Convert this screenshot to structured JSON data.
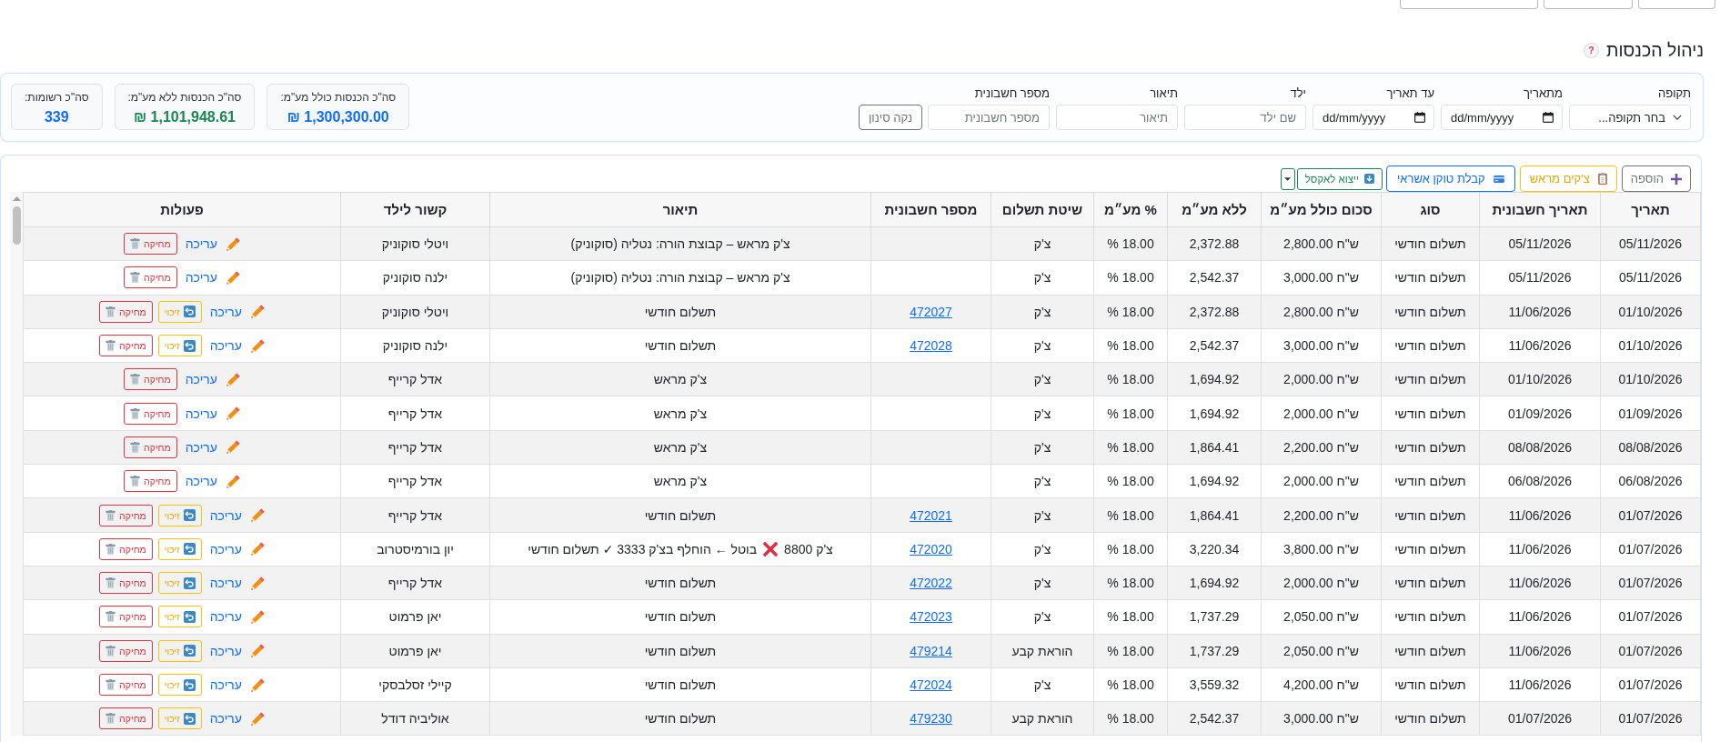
{
  "top_buttons": [
    {
      "kind": "cut-off"
    },
    {
      "kind": "cut-off"
    },
    {
      "kind": "cut-off"
    }
  ],
  "header": {
    "title": "ניהול הכנסות",
    "help": "?"
  },
  "filters": {
    "fields": [
      {
        "kind": "select",
        "label": "תקופה",
        "value": "בחר תקופה..."
      },
      {
        "kind": "date",
        "label": "מתאריך",
        "placeholder": "dd/mm/yyyy"
      },
      {
        "kind": "date",
        "label": "עד תאריך",
        "placeholder": "dd/mm/yyyy"
      },
      {
        "kind": "text",
        "label": "ילד",
        "placeholder": "שם ילד"
      },
      {
        "kind": "text",
        "label": "תיאור",
        "placeholder": "תיאור"
      },
      {
        "kind": "text",
        "label": "מספר חשבונית",
        "placeholder": "מספר חשבונית"
      }
    ],
    "clear_button": "נקה סינון"
  },
  "stats": [
    {
      "label": "סה\"כ הכנסות כולל מע\"מ:",
      "value": "1,300,300.00 ₪",
      "color": "#0d6efd"
    },
    {
      "label": "סה\"כ הכנסות ללא מע\"מ:",
      "value": "1,101,948.61 ₪",
      "color": "#198754"
    },
    {
      "label": "סה\"כ רשומות:",
      "value": "339",
      "color": "#0d6efd"
    }
  ],
  "toolbar": [
    {
      "kind": "add",
      "label": "הוספה"
    },
    {
      "kind": "checks",
      "label": "צ'קים מראש"
    },
    {
      "kind": "token",
      "label": "קבלת טוקן אשראי"
    },
    {
      "kind": "export",
      "label": "ייצוא לאקסל"
    },
    {
      "kind": "dropdown"
    }
  ],
  "table": {
    "scrollable": true,
    "columns": [
      "תאריך",
      "תאריך חשבונית",
      "סוג",
      "סכום כולל מע״מ",
      "ללא מע״מ",
      "% מע״מ",
      "שיטת תשלום",
      "מספר חשבונית",
      "תיאור",
      "קשור לילד",
      "פעולות"
    ],
    "rows": [
      {
        "date": "05/11/2026",
        "invoice_date": "05/11/2026",
        "type": "תשלום חודשי",
        "total": "2,800.00 ש\"ח",
        "net": "2,372.88",
        "vat": "18.00 %",
        "payment_method": "צ'ק",
        "description": "צ'ק מראש – קבוצת הורה: נטליה (סוקוניק)",
        "child": "ויטלי סוקוניק",
        "actions": [
          {
            "kind": "edit",
            "label": "עריכה"
          },
          {
            "kind": "delete",
            "label": "מחיקה"
          }
        ]
      },
      {
        "date": "05/11/2026",
        "invoice_date": "05/11/2026",
        "type": "תשלום חודשי",
        "total": "3,000.00 ש\"ח",
        "net": "2,542.37",
        "vat": "18.00 %",
        "payment_method": "צ'ק",
        "description": "צ'ק מראש – קבוצת הורה: נטליה (סוקוניק)",
        "child": "ילנה סוקוניק",
        "actions": [
          {
            "kind": "edit",
            "label": "עריכה"
          },
          {
            "kind": "delete",
            "label": "מחיקה"
          }
        ]
      },
      {
        "date": "01/10/2026",
        "invoice_date": "11/06/2026",
        "type": "תשלום חודשי",
        "total": "2,800.00 ש\"ח",
        "net": "2,372.88",
        "vat": "18.00 %",
        "payment_method": "צ'ק",
        "invoice_number": "472027",
        "description": "תשלום חודשי",
        "child": "ויטלי סוקוניק",
        "actions": [
          {
            "kind": "edit",
            "label": "עריכה"
          },
          {
            "kind": "credit",
            "label": "זיכוי"
          },
          {
            "kind": "delete",
            "label": "מחיקה"
          }
        ]
      },
      {
        "date": "01/10/2026",
        "invoice_date": "11/06/2026",
        "type": "תשלום חודשי",
        "total": "3,000.00 ש\"ח",
        "net": "2,542.37",
        "vat": "18.00 %",
        "payment_method": "צ'ק",
        "invoice_number": "472028",
        "description": "תשלום חודשי",
        "child": "ילנה סוקוניק",
        "actions": [
          {
            "kind": "edit",
            "label": "עריכה"
          },
          {
            "kind": "credit",
            "label": "זיכוי"
          },
          {
            "kind": "delete",
            "label": "מחיקה"
          }
        ]
      },
      {
        "date": "01/10/2026",
        "invoice_date": "01/10/2026",
        "type": "תשלום חודשי",
        "total": "2,000.00 ש\"ח",
        "net": "1,694.92",
        "vat": "18.00 %",
        "payment_method": "צ'ק",
        "description": "צ'ק מראש",
        "child": "אדל קרייף",
        "actions": [
          {
            "kind": "edit",
            "label": "עריכה"
          },
          {
            "kind": "delete",
            "label": "מחיקה"
          }
        ]
      },
      {
        "date": "01/09/2026",
        "invoice_date": "01/09/2026",
        "type": "תשלום חודשי",
        "total": "2,000.00 ש\"ח",
        "net": "1,694.92",
        "vat": "18.00 %",
        "payment_method": "צ'ק",
        "description": "צ'ק מראש",
        "child": "אדל קרייף",
        "actions": [
          {
            "kind": "edit",
            "label": "עריכה"
          },
          {
            "kind": "delete",
            "label": "מחיקה"
          }
        ]
      },
      {
        "date": "08/08/2026",
        "invoice_date": "08/08/2026",
        "type": "תשלום חודשי",
        "total": "2,200.00 ש\"ח",
        "net": "1,864.41",
        "vat": "18.00 %",
        "payment_method": "צ'ק",
        "description": "צ'ק מראש",
        "child": "אדל קרייף",
        "actions": [
          {
            "kind": "edit",
            "label": "עריכה"
          },
          {
            "kind": "delete",
            "label": "מחיקה"
          }
        ]
      },
      {
        "date": "06/08/2026",
        "invoice_date": "06/08/2026",
        "type": "תשלום חודשי",
        "total": "2,000.00 ש\"ח",
        "net": "1,694.92",
        "vat": "18.00 %",
        "payment_method": "צ'ק",
        "description": "צ'ק מראש",
        "child": "אדל קרייף",
        "actions": [
          {
            "kind": "edit",
            "label": "עריכה"
          },
          {
            "kind": "delete",
            "label": "מחיקה"
          }
        ]
      },
      {
        "date": "01/07/2026",
        "invoice_date": "11/06/2026",
        "type": "תשלום חודשי",
        "total": "2,200.00 ש\"ח",
        "net": "1,864.41",
        "vat": "18.00 %",
        "payment_method": "צ'ק",
        "invoice_number": "472021",
        "description": "תשלום חודשי",
        "child": "אדל קרייף",
        "actions": [
          {
            "kind": "edit",
            "label": "עריכה"
          },
          {
            "kind": "credit",
            "label": "זיכוי"
          },
          {
            "kind": "delete",
            "label": "מחיקה"
          }
        ]
      },
      {
        "date": "01/07/2026",
        "invoice_date": "11/06/2026",
        "type": "תשלום חודשי",
        "total": "3,800.00 ש\"ח",
        "net": "3,220.34",
        "vat": "18.00 %",
        "payment_method": "צ'ק",
        "invoice_number": "472020",
        "description": [
          {
            "kind": "text",
            "text": "צ'ק 8800"
          },
          {
            "kind": "icon"
          },
          {
            "kind": "text",
            "text": "בוטל ← הוחלף בצ'ק 3333 ✓ תשלום חודשי"
          }
        ],
        "child": "יון בורמיסטרוב",
        "actions": [
          {
            "kind": "edit",
            "label": "עריכה"
          },
          {
            "kind": "credit",
            "label": "זיכוי"
          },
          {
            "kind": "delete",
            "label": "מחיקה"
          }
        ]
      },
      {
        "date": "01/07/2026",
        "invoice_date": "11/06/2026",
        "type": "תשלום חודשי",
        "total": "2,000.00 ש\"ח",
        "net": "1,694.92",
        "vat": "18.00 %",
        "payment_method": "צ'ק",
        "invoice_number": "472022",
        "description": "תשלום חודשי",
        "child": "אדל קרייף",
        "actions": [
          {
            "kind": "edit",
            "label": "עריכה"
          },
          {
            "kind": "credit",
            "label": "זיכוי"
          },
          {
            "kind": "delete",
            "label": "מחיקה"
          }
        ]
      },
      {
        "date": "01/07/2026",
        "invoice_date": "11/06/2026",
        "type": "תשלום חודשי",
        "total": "2,050.00 ש\"ח",
        "net": "1,737.29",
        "vat": "18.00 %",
        "payment_method": "צ'ק",
        "invoice_number": "472023",
        "description": "תשלום חודשי",
        "child": "יאן פרמוט",
        "actions": [
          {
            "kind": "edit",
            "label": "עריכה"
          },
          {
            "kind": "credit",
            "label": "זיכוי"
          },
          {
            "kind": "delete",
            "label": "מחיקה"
          }
        ]
      },
      {
        "date": "01/07/2026",
        "invoice_date": "11/06/2026",
        "type": "תשלום חודשי",
        "total": "2,050.00 ש\"ח",
        "net": "1,737.29",
        "vat": "18.00 %",
        "payment_method": "הוראת קבע",
        "invoice_number": "479214",
        "description": "תשלום חודשי",
        "child": "יאן פרמוט",
        "actions": [
          {
            "kind": "edit",
            "label": "עריכה"
          },
          {
            "kind": "credit",
            "label": "זיכוי"
          },
          {
            "kind": "delete",
            "label": "מחיקה"
          }
        ]
      },
      {
        "date": "01/07/2026",
        "invoice_date": "11/06/2026",
        "type": "תשלום חודשי",
        "total": "4,200.00 ש\"ח",
        "net": "3,559.32",
        "vat": "18.00 %",
        "payment_method": "צ'ק",
        "invoice_number": "472024",
        "description": "תשלום חודשי",
        "child": "קיילי זסלבסקי",
        "actions": [
          {
            "kind": "edit",
            "label": "עריכה"
          },
          {
            "kind": "credit",
            "label": "זיכוי"
          },
          {
            "kind": "delete",
            "label": "מחיקה"
          }
        ]
      },
      {
        "date": "01/07/2026",
        "invoice_date": "01/07/2026",
        "type": "תשלום חודשי",
        "total": "3,000.00 ש\"ח",
        "net": "2,542.37",
        "vat": "18.00 %",
        "payment_method": "הוראת קבע",
        "invoice_number": "479230",
        "description": "תשלום חודשי",
        "child": "אוליביה דודל",
        "actions": [
          {
            "kind": "edit",
            "label": "עריכה"
          },
          {
            "kind": "credit",
            "label": "זיכוי"
          },
          {
            "kind": "delete",
            "label": "מחיקה"
          }
        ]
      }
    ]
  }
}
